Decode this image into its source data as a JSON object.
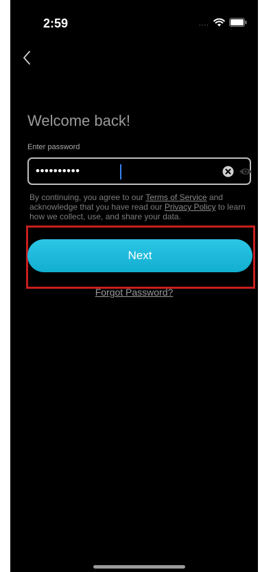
{
  "status_bar": {
    "time": "2:59",
    "signal": "....",
    "wifi_icon": "wifi-icon",
    "battery_icon": "battery-icon"
  },
  "nav": {
    "back_icon": "chevron-left-icon"
  },
  "login": {
    "title": "Welcome back!",
    "password_label": "Enter password",
    "password_value": "••••••••••",
    "clear_icon": "clear-icon",
    "visibility_icon": "eye-icon"
  },
  "legal": {
    "prefix": "By continuing, you agree to our ",
    "terms_link": "Terms of Service",
    "middle": " and acknowledge that you have read our ",
    "privacy_link": "Privacy Policy",
    "suffix": " to learn how we collect, use, and share your data."
  },
  "actions": {
    "next_label": "Next",
    "forgot_label": "Forgot Password?"
  },
  "colors": {
    "background": "#000000",
    "accent": "#1bb8dc",
    "highlight": "#c81e1e"
  }
}
